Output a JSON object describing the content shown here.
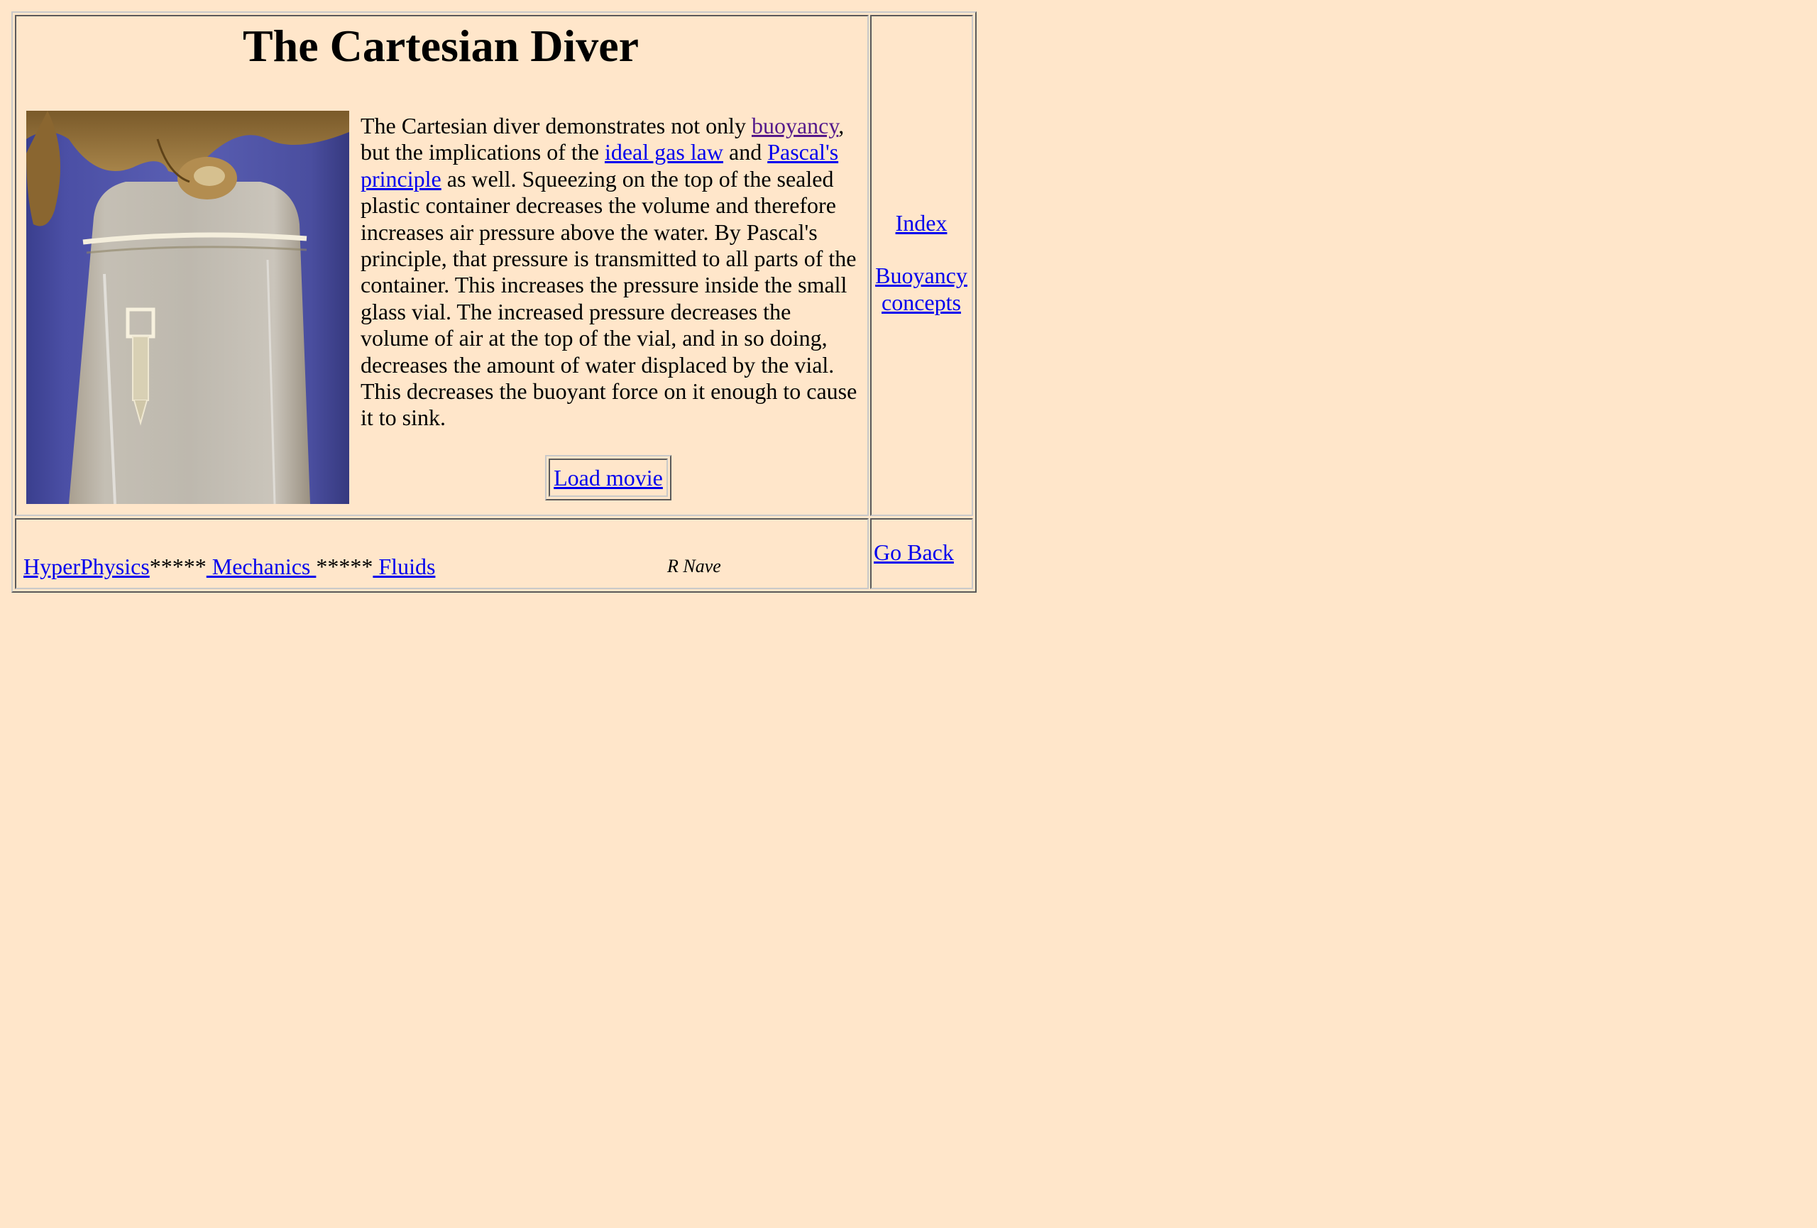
{
  "header": {
    "title": "The Cartesian Diver"
  },
  "photo": {
    "description_icon": "cartesian-diver-photo"
  },
  "body": {
    "p1": "The Cartesian diver demonstrates not only ",
    "link_buoyancy": "buoyancy",
    "p2": ", but the implications of the ",
    "link_ideal_gas": "ideal gas law",
    "p3": " and ",
    "link_pascal": "Pascal's principle",
    "p4": " as well. Squeezing on the top of the sealed plastic container decreases the volume and therefore increases air pressure above the water. By Pascal's principle, that pressure is transmitted to all parts of the container. This increases the pressure inside the small glass vial. The increased pressure decreases the volume of air at the top of the vial, and in so doing, decreases the amount of water displaced by the vial. This decreases the buoyant force on it enough to cause it to sink."
  },
  "movie_button": {
    "label": "Load movie"
  },
  "side_nav": {
    "index": "Index",
    "buoyancy_concepts": "Buoyancy concepts"
  },
  "footer": {
    "hyperphysics": "HyperPhysics",
    "sep1": "*****",
    "mechanics": " Mechanics ",
    "sep2": "*****",
    "fluids": " Fluids",
    "author": "R Nave",
    "go_back": "Go Back"
  },
  "colors": {
    "background": "#FFE6CA",
    "link": "#0000EE",
    "visited_link": "#551A8B"
  }
}
